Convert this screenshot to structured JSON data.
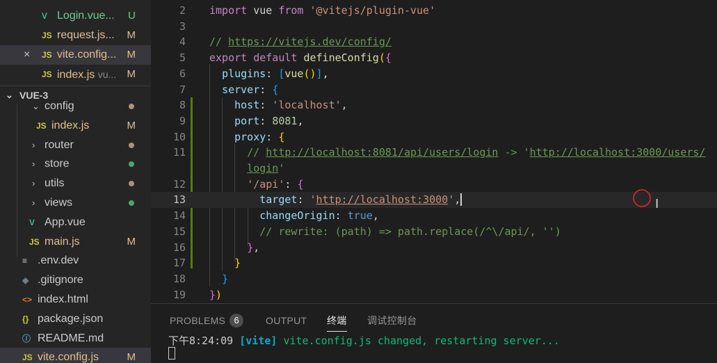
{
  "colors": {
    "sidebar_bg": "#252526",
    "editor_bg": "#1e1e1e",
    "active_row": "#37373d",
    "modified": "#e2c08d",
    "untracked": "#73c991",
    "vue_icon": "#41b883",
    "js_icon": "#cbcb41"
  },
  "sidebar": {
    "open_editors": [
      {
        "icon": "vue-icon",
        "icon_glyph": "V",
        "name": "Login.vue...",
        "hint": "",
        "badge": "U",
        "status": "untracked"
      },
      {
        "icon": "js-icon",
        "icon_glyph": "JS",
        "name": "request.js...",
        "hint": "",
        "badge": "M",
        "status": "modified"
      },
      {
        "icon": "js-icon",
        "icon_glyph": "JS",
        "name": "vite.config...",
        "hint": "",
        "badge": "M",
        "status": "modified",
        "close": "×"
      },
      {
        "icon": "js-icon",
        "icon_glyph": "JS",
        "name": "index.js",
        "hint": "vu...",
        "badge": "M",
        "status": "modified"
      }
    ],
    "section": {
      "chevron": "⌄",
      "title": "VUE-3"
    },
    "tree": [
      {
        "kind": "folder",
        "expanded": true,
        "chevron": "⌄",
        "name": "config",
        "dot": "modified"
      },
      {
        "kind": "file",
        "icon": "js-icon",
        "icon_glyph": "JS",
        "name": "index.js",
        "badge": "M",
        "status": "modified"
      },
      {
        "kind": "folder",
        "expanded": false,
        "chevron": "›",
        "name": "router",
        "dot": "modified"
      },
      {
        "kind": "folder",
        "expanded": false,
        "chevron": "›",
        "name": "store",
        "dot": "untracked"
      },
      {
        "kind": "folder",
        "expanded": false,
        "chevron": "›",
        "name": "utils",
        "dot": "modified"
      },
      {
        "kind": "folder",
        "expanded": false,
        "chevron": "›",
        "name": "views",
        "dot": "untracked"
      },
      {
        "kind": "file",
        "icon": "vue-icon",
        "icon_glyph": "V",
        "name": "App.vue",
        "badge": "",
        "status": "modified"
      },
      {
        "kind": "file",
        "icon": "js-icon",
        "icon_glyph": "JS",
        "name": "main.js",
        "badge": "M",
        "status": "modified"
      },
      {
        "kind": "file",
        "icon": "config-icon",
        "icon_glyph": "≡",
        "name": ".env.dev",
        "badge": "",
        "status": "none"
      },
      {
        "kind": "file",
        "icon": "git-icon",
        "icon_glyph": "◆",
        "name": ".gitignore",
        "badge": "",
        "status": "none"
      },
      {
        "kind": "file",
        "icon": "html-icon",
        "icon_glyph": "<>",
        "name": "index.html",
        "badge": "",
        "status": "none"
      },
      {
        "kind": "file",
        "icon": "json-icon",
        "icon_glyph": "{}",
        "name": "package.json",
        "badge": "",
        "status": "none"
      },
      {
        "kind": "file",
        "icon": "info-icon",
        "icon_glyph": "ⓘ",
        "name": "README.md",
        "badge": "",
        "status": "none"
      },
      {
        "kind": "file",
        "icon": "js-icon",
        "icon_glyph": "JS",
        "name": "vite.config.js",
        "badge": "M",
        "status": "modified",
        "active": true
      }
    ]
  },
  "editor": {
    "file": "vite.config.js",
    "current_line": "13",
    "lines": [
      {
        "n": "2",
        "tokens": [
          [
            "kw",
            "import"
          ],
          [
            "pun",
            " vue "
          ],
          [
            "kw",
            "from"
          ],
          [
            "pun",
            " "
          ],
          [
            "str",
            "'@vitejs/plugin-vue'"
          ]
        ]
      },
      {
        "n": "3",
        "tokens": []
      },
      {
        "n": "4",
        "tokens": [
          [
            "com",
            "// "
          ],
          [
            "comu",
            "https://vitejs.dev/config/"
          ]
        ]
      },
      {
        "n": "5",
        "tokens": [
          [
            "kw",
            "export"
          ],
          [
            "pun",
            " "
          ],
          [
            "kw",
            "default"
          ],
          [
            "pun",
            " "
          ],
          [
            "fn",
            "defineConfig"
          ],
          [
            "b1",
            "("
          ],
          [
            "b2",
            "{"
          ]
        ]
      },
      {
        "n": "6",
        "tokens": [
          [
            "pun",
            "  "
          ],
          [
            "prop",
            "plugins"
          ],
          [
            "pun",
            ": "
          ],
          [
            "b3",
            "["
          ],
          [
            "fn",
            "vue"
          ],
          [
            "b1",
            "()"
          ],
          [
            "b3",
            "]"
          ],
          [
            "pun",
            ","
          ]
        ]
      },
      {
        "n": "7",
        "tokens": [
          [
            "pun",
            "  "
          ],
          [
            "prop",
            "server"
          ],
          [
            "pun",
            ": "
          ],
          [
            "b3",
            "{"
          ]
        ]
      },
      {
        "n": "8",
        "tokens": [
          [
            "pun",
            "    "
          ],
          [
            "prop",
            "host"
          ],
          [
            "pun",
            ": "
          ],
          [
            "str",
            "'localhost'"
          ],
          [
            "pun",
            ","
          ]
        ]
      },
      {
        "n": "9",
        "tokens": [
          [
            "pun",
            "    "
          ],
          [
            "prop",
            "port"
          ],
          [
            "pun",
            ": "
          ],
          [
            "num",
            "8081"
          ],
          [
            "pun",
            ","
          ]
        ]
      },
      {
        "n": "10",
        "tokens": [
          [
            "pun",
            "    "
          ],
          [
            "prop",
            "proxy"
          ],
          [
            "pun",
            ": "
          ],
          [
            "b1",
            "{"
          ]
        ]
      },
      {
        "n": "11",
        "tokens": [
          [
            "pun",
            "      "
          ],
          [
            "com",
            "// "
          ],
          [
            "comu",
            "http://localhost:8081/api/users/login"
          ],
          [
            "com",
            " -> '"
          ],
          [
            "comu",
            "http://localhost:3000/users/"
          ]
        ]
      },
      {
        "n": "",
        "tokens": [
          [
            "pun",
            "      "
          ],
          [
            "comu",
            "login"
          ],
          [
            "com",
            "'"
          ]
        ]
      },
      {
        "n": "12",
        "tokens": [
          [
            "pun",
            "      "
          ],
          [
            "str",
            "'/api'"
          ],
          [
            "pun",
            ": "
          ],
          [
            "b2",
            "{"
          ]
        ]
      },
      {
        "n": "13",
        "tokens": [
          [
            "pun",
            "        "
          ],
          [
            "prop",
            "target"
          ],
          [
            "pun",
            ": "
          ],
          [
            "str",
            "'"
          ],
          [
            "stru",
            "http://localhost:3000"
          ],
          [
            "str",
            "'"
          ],
          [
            "pun",
            ","
          ],
          [
            "caret",
            ""
          ]
        ]
      },
      {
        "n": "14",
        "tokens": [
          [
            "pun",
            "        "
          ],
          [
            "prop",
            "changeOrigin"
          ],
          [
            "pun",
            ": "
          ],
          [
            "kw2",
            "true"
          ],
          [
            "pun",
            ","
          ]
        ]
      },
      {
        "n": "15",
        "tokens": [
          [
            "pun",
            "        "
          ],
          [
            "com",
            "// rewrite: (path) => path.replace(/^\\/api/, '')"
          ]
        ]
      },
      {
        "n": "16",
        "tokens": [
          [
            "pun",
            "      "
          ],
          [
            "b2",
            "}"
          ],
          [
            "pun",
            ","
          ]
        ]
      },
      {
        "n": "17",
        "tokens": [
          [
            "pun",
            "    "
          ],
          [
            "b1",
            "}"
          ]
        ]
      },
      {
        "n": "18",
        "tokens": [
          [
            "pun",
            "  "
          ],
          [
            "b3",
            "}"
          ]
        ]
      },
      {
        "n": "19",
        "tokens": [
          [
            "b2",
            "}"
          ],
          [
            "b1",
            ")"
          ]
        ]
      }
    ]
  },
  "panel": {
    "tabs": [
      {
        "label": "PROBLEMS",
        "badge": "6",
        "active": false
      },
      {
        "label": "OUTPUT",
        "badge": "",
        "active": false
      },
      {
        "label": "终端",
        "badge": "",
        "active": true
      },
      {
        "label": "调试控制台",
        "badge": "",
        "active": false
      }
    ],
    "terminal": {
      "time": "下午8:24:09",
      "tag": "[vite]",
      "message": "vite.config.js changed, restarting server..."
    }
  }
}
